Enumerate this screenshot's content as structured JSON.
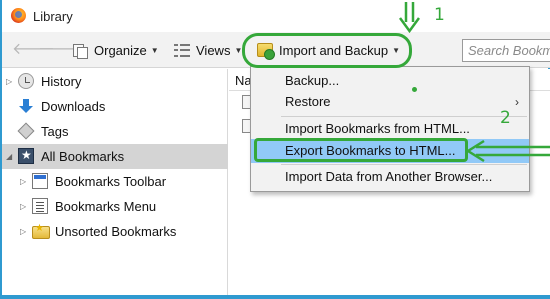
{
  "window": {
    "title": "Library"
  },
  "toolbar": {
    "organize_label": "Organize",
    "views_label": "Views",
    "import_label": "Import and Backup",
    "search_placeholder": "Search Bookmarks"
  },
  "sidebar": {
    "items": [
      {
        "label": "History"
      },
      {
        "label": "Downloads"
      },
      {
        "label": "Tags"
      },
      {
        "label": "All Bookmarks"
      },
      {
        "label": "Bookmarks Toolbar"
      },
      {
        "label": "Bookmarks Menu"
      },
      {
        "label": "Unsorted Bookmarks"
      }
    ]
  },
  "content": {
    "column_name": "Na"
  },
  "menu": {
    "items": [
      {
        "label": "Backup..."
      },
      {
        "label": "Restore"
      },
      {
        "label": "Import Bookmarks from HTML..."
      },
      {
        "label": "Export Bookmarks to HTML..."
      },
      {
        "label": "Import Data from Another Browser..."
      }
    ]
  },
  "annotations": {
    "step1": "1",
    "step2": "2"
  },
  "colors": {
    "annotation_green": "#35a83a",
    "menu_highlight": "#91c9f7",
    "frame_blue": "#2f9ad0"
  }
}
